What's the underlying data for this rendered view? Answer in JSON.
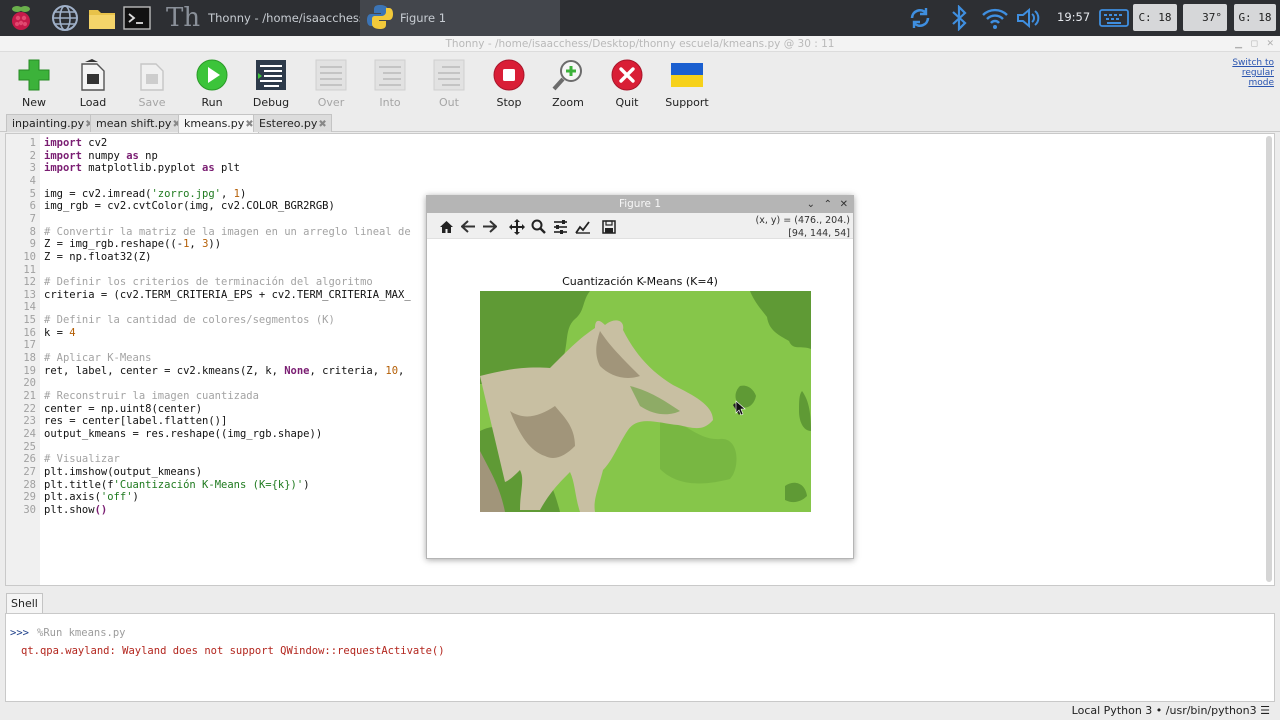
{
  "taskbar": {
    "task1_label": "Thonny  -  /home/isaacchess/Des...",
    "task2_label": "Figure 1",
    "clock": "19:57",
    "cpu": "C: 18",
    "temp": "37°",
    "gpu": "G: 18"
  },
  "window": {
    "title": "Thonny  -  /home/isaacchess/Desktop/thonny escuela/kmeans.py  @  30 : 11"
  },
  "toolbar": {
    "new": "New",
    "load": "Load",
    "save": "Save",
    "run": "Run",
    "debug": "Debug",
    "over": "Over",
    "into": "Into",
    "out": "Out",
    "stop": "Stop",
    "zoom": "Zoom",
    "quit": "Quit",
    "support": "Support",
    "switch_mode": [
      "Switch to",
      "regular",
      "mode"
    ]
  },
  "tabs": [
    {
      "label": "inpainting.py"
    },
    {
      "label": "mean shift.py"
    },
    {
      "label": "kmeans.py"
    },
    {
      "label": "Estereo.py"
    }
  ],
  "editor": {
    "line_numbers": [
      "1",
      "2",
      "3",
      "4",
      "5",
      "6",
      "7",
      "8",
      "9",
      "10",
      "11",
      "12",
      "13",
      "14",
      "15",
      "16",
      "17",
      "18",
      "19",
      "20",
      "21",
      "22",
      "23",
      "24",
      "25",
      "26",
      "27",
      "28",
      "29",
      "30"
    ],
    "lines": [
      [
        {
          "t": "import",
          "c": "kw"
        },
        {
          "t": " cv2"
        }
      ],
      [
        {
          "t": "import",
          "c": "kw"
        },
        {
          "t": " numpy "
        },
        {
          "t": "as",
          "c": "kw"
        },
        {
          "t": " np"
        }
      ],
      [
        {
          "t": "import",
          "c": "kw"
        },
        {
          "t": " matplotlib.pyplot "
        },
        {
          "t": "as",
          "c": "kw"
        },
        {
          "t": " plt"
        }
      ],
      [],
      [
        {
          "t": "img = cv2.imread("
        },
        {
          "t": "'zorro.jpg'",
          "c": "st"
        },
        {
          "t": ", "
        },
        {
          "t": "1",
          "c": "nm"
        },
        {
          "t": ")"
        }
      ],
      [
        {
          "t": "img_rgb = cv2.cvtColor(img, cv2.COLOR_BGR2RGB)"
        }
      ],
      [],
      [
        {
          "t": "# Convertir la matriz de la imagen en un arreglo lineal de",
          "c": "cm"
        }
      ],
      [
        {
          "t": "Z = img_rgb.reshape((-"
        },
        {
          "t": "1",
          "c": "nm"
        },
        {
          "t": ", "
        },
        {
          "t": "3",
          "c": "nm"
        },
        {
          "t": "))"
        }
      ],
      [
        {
          "t": "Z = np.float32(Z)"
        }
      ],
      [],
      [
        {
          "t": "# Definir los criterios de terminación del algoritmo",
          "c": "cm"
        }
      ],
      [
        {
          "t": "criteria = (cv2.TERM_CRITERIA_EPS + cv2.TERM_CRITERIA_MAX_"
        }
      ],
      [],
      [
        {
          "t": "# Definir la cantidad de colores/segmentos (K)",
          "c": "cm"
        }
      ],
      [
        {
          "t": "k = "
        },
        {
          "t": "4",
          "c": "nm"
        }
      ],
      [],
      [
        {
          "t": "# Aplicar K-Means",
          "c": "cm"
        }
      ],
      [
        {
          "t": "ret, label, center = cv2.kmeans(Z, k, "
        },
        {
          "t": "None",
          "c": "kw"
        },
        {
          "t": ", criteria, "
        },
        {
          "t": "10",
          "c": "nm"
        },
        {
          "t": ","
        }
      ],
      [],
      [
        {
          "t": "# Reconstruir la imagen cuantizada",
          "c": "cm"
        }
      ],
      [
        {
          "t": "center = np.uint8(center)"
        }
      ],
      [
        {
          "t": "res = center[label.flatten()]"
        }
      ],
      [
        {
          "t": "output_kmeans = res.reshape((img_rgb.shape))"
        }
      ],
      [],
      [
        {
          "t": "# Visualizar",
          "c": "cm"
        }
      ],
      [
        {
          "t": "plt.imshow(output_kmeans)"
        }
      ],
      [
        {
          "t": "plt.title(f"
        },
        {
          "t": "'Cuantización K-Means (K={k})'",
          "c": "st"
        },
        {
          "t": ")"
        }
      ],
      [
        {
          "t": "plt.axis("
        },
        {
          "t": "'off'",
          "c": "st"
        },
        {
          "t": ")"
        }
      ],
      [
        {
          "t": "plt.show"
        },
        {
          "t": "()",
          "c": "kw"
        }
      ]
    ]
  },
  "shell": {
    "tab_label": "Shell",
    "prompt": ">>>",
    "command": "%Run kmeans.py",
    "error": "qt.qpa.wayland: Wayland does not support QWindow::requestActivate()"
  },
  "statusbar": {
    "text": "Local Python 3  •  /usr/bin/python3"
  },
  "figure": {
    "window_title": "Figure 1",
    "coords_line1": "(x, y) = (476., 204.)",
    "coords_line2": "[94, 144, 54]",
    "plot_title": "Cuantización K-Means (K=4)",
    "palette": {
      "dark_green": "#5f9a35",
      "light_green": "#86c64a",
      "beige": "#c8bfa2",
      "brown": "#a1957a"
    }
  }
}
